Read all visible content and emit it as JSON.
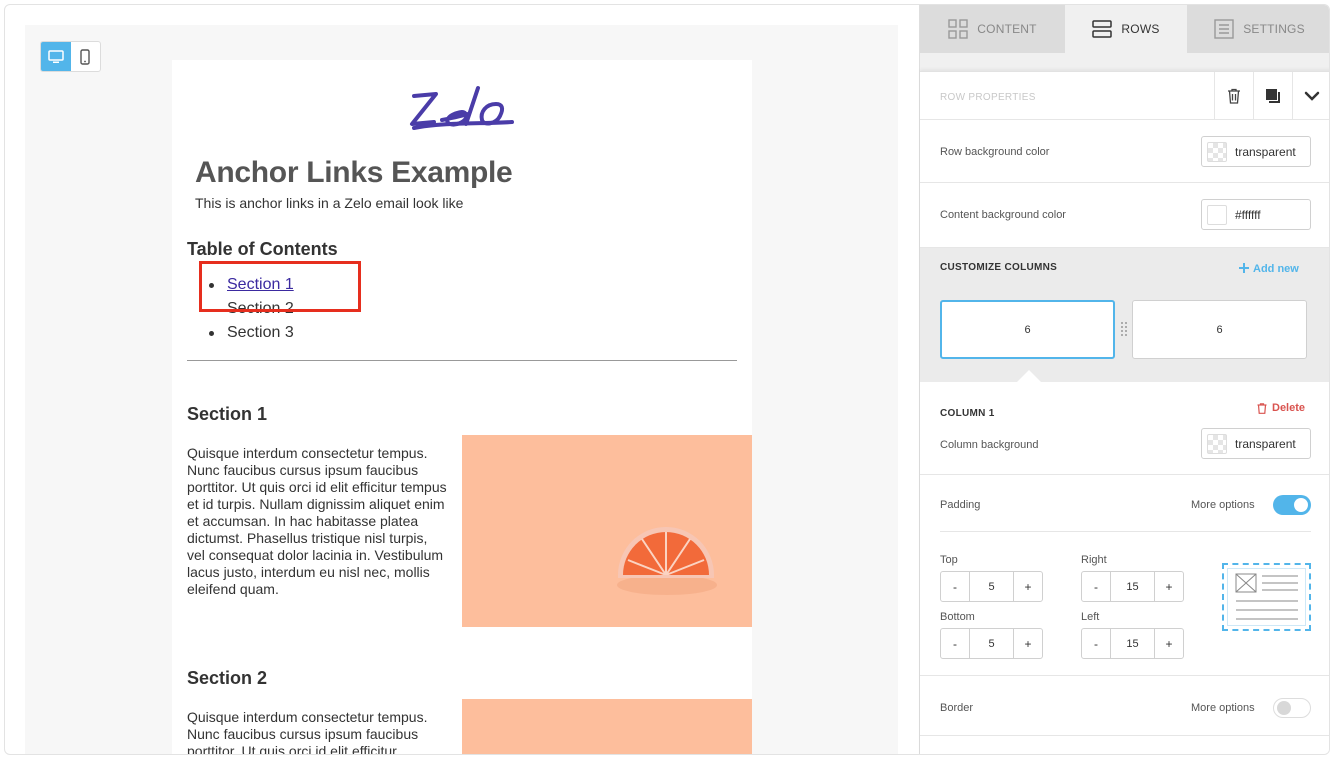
{
  "toolbar": {
    "desktop_icon": "desktop-icon",
    "mobile_icon": "mobile-icon"
  },
  "email": {
    "logo_text": "ZELO",
    "brand_color": "#4a3ca8",
    "headline": "Anchor Links Example",
    "subline": "This is  anchor links in a Zelo email look like",
    "toc_title": "Table of Contents",
    "toc_items": [
      "Section 1",
      "Section 2",
      "Section 3"
    ],
    "sections": [
      {
        "title": "Section 1",
        "text": "Quisque interdum consectetur tempus. Nunc faucibus cursus ipsum faucibus porttitor. Ut quis orci id elit efficitur tempus et id turpis. Nullam dignissim aliquet enim et accumsan. In hac habitasse platea dictumst. Phasellus tristique nisl turpis, vel consequat dolor lacinia in. Vestibulum lacus justo, interdum eu nisl nec, mollis eleifend quam."
      },
      {
        "title": "Section 2",
        "text": "Quisque interdum consectetur tempus. Nunc faucibus cursus ipsum faucibus porttitor. Ut quis orci id elit efficitur"
      }
    ]
  },
  "panel": {
    "tabs": [
      {
        "label": "CONTENT",
        "icon": "grid-icon"
      },
      {
        "label": "ROWS",
        "icon": "rows-icon"
      },
      {
        "label": "SETTINGS",
        "icon": "settings-icon"
      }
    ],
    "row_properties_title": "ROW PROPERTIES",
    "row_bg_label": "Row background color",
    "row_bg_value": "transparent",
    "content_bg_label": "Content background color",
    "content_bg_value": "#ffffff",
    "customize_title": "CUSTOMIZE COLUMNS",
    "add_new": "Add new",
    "columns": [
      "6",
      "6"
    ],
    "column_title": "COLUMN 1",
    "delete_label": "Delete",
    "column_bg_label": "Column background",
    "column_bg_value": "transparent",
    "padding_label": "Padding",
    "more_options": "More options",
    "padding": {
      "top_label": "Top",
      "top": "5",
      "right_label": "Right",
      "right": "15",
      "bottom_label": "Bottom",
      "bottom": "5",
      "left_label": "Left",
      "left": "15"
    },
    "border_label": "Border",
    "accent_color": "#52b5ea",
    "delete_color": "#d9534f"
  }
}
